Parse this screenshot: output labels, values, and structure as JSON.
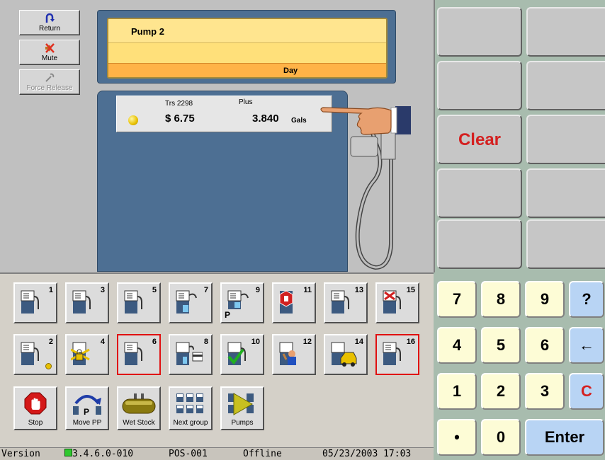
{
  "side_buttons": {
    "return_label": "Return",
    "mute_label": "Mute",
    "force_release_label": "Force Release"
  },
  "pump_display": {
    "title": "Pump 2",
    "mode": "Day"
  },
  "transaction": {
    "trs_label": "Trs 2298",
    "grade": "Plus",
    "amount": "$ 6.75",
    "volume": "3.840",
    "unit": "Gals"
  },
  "pump_buttons": [
    {
      "num": "1"
    },
    {
      "num": "3"
    },
    {
      "num": "5"
    },
    {
      "num": "7"
    },
    {
      "num": "9",
      "sub": "P"
    },
    {
      "num": "11"
    },
    {
      "num": "13"
    },
    {
      "num": "15"
    },
    {
      "num": "2"
    },
    {
      "num": "4"
    },
    {
      "num": "6"
    },
    {
      "num": "8"
    },
    {
      "num": "10"
    },
    {
      "num": "12"
    },
    {
      "num": "14"
    },
    {
      "num": "16"
    }
  ],
  "actions": {
    "stop": "Stop",
    "move_pp": "Move PP",
    "wet_stock": "Wet Stock",
    "next_group": "Next group",
    "pumps": "Pumps"
  },
  "move_pp_badge": "P",
  "status": {
    "version_label": "Version",
    "version_num": "3.4.6.0-010",
    "pos": "POS-001",
    "connection": "Offline",
    "datetime": "05/23/2003 17:03"
  },
  "function_keys": {
    "clear": "Clear"
  },
  "keypad": {
    "k7": "7",
    "k8": "8",
    "k9": "9",
    "help": "?",
    "k4": "4",
    "k5": "5",
    "k6": "6",
    "back": "←",
    "k1": "1",
    "k2": "2",
    "k3": "3",
    "cancel": "C",
    "dot": "•",
    "k0": "0",
    "enter": "Enter"
  },
  "colors": {
    "selected_border": "#e01010",
    "pump_blue": "#4d6f93",
    "display_yellow": "#ffe07a",
    "keypad_cream": "#fdfcd6",
    "keypad_blue": "#b8d4f4",
    "accent_red": "#d42020"
  }
}
